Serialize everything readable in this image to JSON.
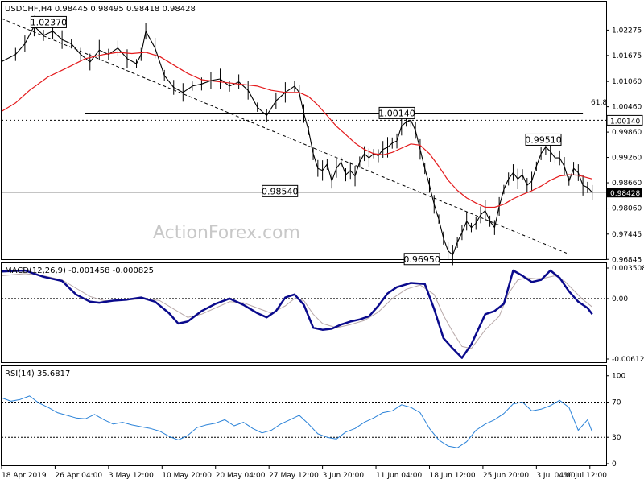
{
  "chart_data": [
    {
      "type": "line",
      "title": "USDCHF,H4",
      "ohlc_label": "0.98445 0.98495 0.98418 0.98428",
      "watermark": "ActionForex.com",
      "ylim": [
        0.9685,
        1.0295
      ],
      "y_ticks": [
        "1.02275",
        "1.01675",
        "1.01060",
        "1.00460",
        "0.99860",
        "0.99260",
        "0.98660",
        "0.98060",
        "0.97445",
        "0.96845"
      ],
      "current_price": "0.98428",
      "fib_label": "61.8",
      "fib_level": 1.0014,
      "fib_value_label": "1.00140",
      "fib_line": {
        "x": [
          18,
          125
        ],
        "y": 1.0031
      },
      "trendline": {
        "x": [
          0,
          122
        ],
        "y": [
          1.0255,
          0.9697
        ]
      },
      "x_range": [
        0,
        130
      ],
      "annotations": [
        {
          "text": "1.02370",
          "x": 7.0,
          "y": 1.0237
        },
        {
          "text": "0.98540",
          "x": 64.0,
          "y": 0.9854
        },
        {
          "text": "1.00140",
          "x": 85.0,
          "y": 1.0014
        },
        {
          "text": "0.96950",
          "x": 93.5,
          "y": 0.9695
        },
        {
          "text": "0.99510",
          "x": 116.5,
          "y": 0.9951
        }
      ],
      "price_points": [
        [
          0,
          1.0153
        ],
        [
          3,
          1.017
        ],
        [
          5,
          1.0195
        ],
        [
          7,
          1.0237
        ],
        [
          9,
          1.0215
        ],
        [
          11,
          1.0225
        ],
        [
          13,
          1.0205
        ],
        [
          15,
          1.0195
        ],
        [
          17,
          1.017
        ],
        [
          19,
          1.0152
        ],
        [
          21,
          1.018
        ],
        [
          23,
          1.017
        ],
        [
          25,
          1.0185
        ],
        [
          27,
          1.016
        ],
        [
          29,
          1.0148
        ],
        [
          30,
          1.017
        ],
        [
          31,
          1.0225
        ],
        [
          33,
          1.0185
        ],
        [
          35,
          1.012
        ],
        [
          37,
          1.0092
        ],
        [
          39,
          1.008
        ],
        [
          41,
          1.0095
        ],
        [
          43,
          1.01
        ],
        [
          45,
          1.0108
        ],
        [
          47,
          1.0112
        ],
        [
          49,
          1.0095
        ],
        [
          51,
          1.0105
        ],
        [
          53,
          1.0085
        ],
        [
          55,
          1.0045
        ],
        [
          57,
          1.0025
        ],
        [
          59,
          1.006
        ],
        [
          61,
          1.008
        ],
        [
          63,
          1.0095
        ],
        [
          64,
          1.008
        ],
        [
          65,
          1.003
        ],
        [
          66,
          0.999
        ],
        [
          67,
          0.9935
        ],
        [
          68,
          0.99
        ],
        [
          69,
          0.9895
        ],
        [
          70,
          0.991
        ],
        [
          71,
          0.987
        ],
        [
          72,
          0.99
        ],
        [
          73,
          0.9915
        ],
        [
          74,
          0.9885
        ],
        [
          75,
          0.9895
        ],
        [
          76,
          0.9882
        ],
        [
          77,
          0.9915
        ],
        [
          78,
          0.9935
        ],
        [
          79,
          0.9925
        ],
        [
          80,
          0.9935
        ],
        [
          81,
          0.993
        ],
        [
          82,
          0.9945
        ],
        [
          83,
          0.995
        ],
        [
          84,
          0.996
        ],
        [
          85,
          0.9965
        ],
        [
          86,
          1.0
        ],
        [
          87,
          1.001
        ],
        [
          88,
          1.0014
        ],
        [
          89,
          0.999
        ],
        [
          90,
          0.9945
        ],
        [
          91,
          0.99
        ],
        [
          92,
          0.986
        ],
        [
          93,
          0.9815
        ],
        [
          94,
          0.978
        ],
        [
          95,
          0.9735
        ],
        [
          96,
          0.9705
        ],
        [
          97,
          0.9695
        ],
        [
          98,
          0.9725
        ],
        [
          99,
          0.9748
        ],
        [
          100,
          0.9775
        ],
        [
          101,
          0.976
        ],
        [
          102,
          0.977
        ],
        [
          103,
          0.979
        ],
        [
          104,
          0.98
        ],
        [
          105,
          0.9775
        ],
        [
          106,
          0.976
        ],
        [
          107,
          0.981
        ],
        [
          108,
          0.985
        ],
        [
          109,
          0.9875
        ],
        [
          110,
          0.989
        ],
        [
          111,
          0.9875
        ],
        [
          112,
          0.9885
        ],
        [
          113,
          0.986
        ],
        [
          114,
          0.987
        ],
        [
          115,
          0.9905
        ],
        [
          116,
          0.9935
        ],
        [
          117,
          0.9951
        ],
        [
          118,
          0.994
        ],
        [
          119,
          0.9925
        ],
        [
          120,
          0.9925
        ],
        [
          121,
          0.9905
        ],
        [
          122,
          0.987
        ],
        [
          123,
          0.99
        ],
        [
          124,
          0.989
        ],
        [
          125,
          0.986
        ],
        [
          126,
          0.9855
        ],
        [
          127,
          0.9843
        ]
      ],
      "ma_points": [
        [
          0,
          1.0035
        ],
        [
          3,
          1.0055
        ],
        [
          6,
          1.0085
        ],
        [
          10,
          1.0117
        ],
        [
          14,
          1.0138
        ],
        [
          18,
          1.016
        ],
        [
          22,
          1.017
        ],
        [
          25,
          1.0175
        ],
        [
          28,
          1.0172
        ],
        [
          31,
          1.0175
        ],
        [
          34,
          1.0165
        ],
        [
          37,
          1.0145
        ],
        [
          40,
          1.0125
        ],
        [
          43,
          1.011
        ],
        [
          47,
          1.0105
        ],
        [
          51,
          1.01
        ],
        [
          55,
          1.0095
        ],
        [
          58,
          1.0085
        ],
        [
          61,
          1.008
        ],
        [
          64,
          1.008
        ],
        [
          66,
          1.007
        ],
        [
          68,
          1.005
        ],
        [
          70,
          1.0025
        ],
        [
          72,
          1.0
        ],
        [
          74,
          0.998
        ],
        [
          76,
          0.996
        ],
        [
          78,
          0.9945
        ],
        [
          80,
          0.9935
        ],
        [
          82,
          0.9932
        ],
        [
          84,
          0.9938
        ],
        [
          86,
          0.9948
        ],
        [
          88,
          0.9958
        ],
        [
          90,
          0.9955
        ],
        [
          92,
          0.9935
        ],
        [
          94,
          0.9905
        ],
        [
          96,
          0.9872
        ],
        [
          98,
          0.9848
        ],
        [
          100,
          0.983
        ],
        [
          102,
          0.9818
        ],
        [
          104,
          0.9808
        ],
        [
          106,
          0.9808
        ],
        [
          108,
          0.9815
        ],
        [
          110,
          0.9828
        ],
        [
          112,
          0.9838
        ],
        [
          114,
          0.9847
        ],
        [
          116,
          0.9858
        ],
        [
          118,
          0.9872
        ],
        [
          120,
          0.9882
        ],
        [
          122,
          0.9885
        ],
        [
          124,
          0.9884
        ],
        [
          126,
          0.9878
        ],
        [
          127,
          0.9875
        ]
      ]
    },
    {
      "type": "line",
      "title": "MACD(12,26,9) -0.001458 -0.000825",
      "ylim": [
        -0.00612,
        0.0034
      ],
      "y_ticks": [
        "0.003508",
        "0.00",
        "-0.006121"
      ],
      "zero_line": 0,
      "macd_points": [
        [
          0,
          0.0026
        ],
        [
          5,
          0.0027
        ],
        [
          9,
          0.0021
        ],
        [
          13,
          0.0017
        ],
        [
          16,
          0.0004
        ],
        [
          19,
          -0.0003
        ],
        [
          21,
          -0.0004
        ],
        [
          24,
          -0.0002
        ],
        [
          27,
          -0.0001
        ],
        [
          30,
          0.0001
        ],
        [
          33,
          -0.0003
        ],
        [
          36,
          -0.0014
        ],
        [
          38,
          -0.0024
        ],
        [
          40,
          -0.0022
        ],
        [
          43,
          -0.0012
        ],
        [
          46,
          -0.0005
        ],
        [
          49,
          0.0
        ],
        [
          52,
          -0.0006
        ],
        [
          55,
          -0.0014
        ],
        [
          57,
          -0.0018
        ],
        [
          59,
          -0.0012
        ],
        [
          61,
          0.0001
        ],
        [
          63,
          0.0004
        ],
        [
          65,
          -0.0006
        ],
        [
          67,
          -0.0028
        ],
        [
          69,
          -0.003
        ],
        [
          71,
          -0.0029
        ],
        [
          73,
          -0.0025
        ],
        [
          75,
          -0.0022
        ],
        [
          77,
          -0.002
        ],
        [
          79,
          -0.0017
        ],
        [
          81,
          -0.0007
        ],
        [
          83,
          0.0005
        ],
        [
          85,
          0.0011
        ],
        [
          88,
          0.0015
        ],
        [
          91,
          0.0014
        ],
        [
          93,
          -0.001
        ],
        [
          95,
          -0.0038
        ],
        [
          97,
          -0.0048
        ],
        [
          99,
          -0.0057
        ],
        [
          101,
          -0.0044
        ],
        [
          104,
          -0.0015
        ],
        [
          106,
          -0.0012
        ],
        [
          108,
          -0.0005
        ],
        [
          110,
          0.0027
        ],
        [
          112,
          0.0022
        ],
        [
          114,
          0.0016
        ],
        [
          116,
          0.0018
        ],
        [
          118,
          0.0027
        ],
        [
          120,
          0.002
        ],
        [
          122,
          0.0007
        ],
        [
          124,
          -0.0003
        ],
        [
          126,
          -0.0009
        ],
        [
          127,
          -0.0015
        ]
      ],
      "signal_points": [
        [
          0,
          0.0022
        ],
        [
          5,
          0.0024
        ],
        [
          9,
          0.0022
        ],
        [
          13,
          0.0018
        ],
        [
          16,
          0.001
        ],
        [
          19,
          0.0002
        ],
        [
          22,
          -0.0002
        ],
        [
          25,
          -0.0002
        ],
        [
          28,
          -0.0001
        ],
        [
          31,
          0.0
        ],
        [
          34,
          -0.0002
        ],
        [
          37,
          -0.001
        ],
        [
          40,
          -0.0018
        ],
        [
          43,
          -0.0015
        ],
        [
          46,
          -0.0009
        ],
        [
          49,
          -0.0003
        ],
        [
          52,
          -0.0004
        ],
        [
          55,
          -0.0009
        ],
        [
          58,
          -0.0014
        ],
        [
          61,
          -0.0007
        ],
        [
          63,
          0.0
        ],
        [
          65,
          -0.0002
        ],
        [
          67,
          -0.0015
        ],
        [
          69,
          -0.0024
        ],
        [
          72,
          -0.0028
        ],
        [
          75,
          -0.0025
        ],
        [
          78,
          -0.0021
        ],
        [
          81,
          -0.0013
        ],
        [
          84,
          0.0
        ],
        [
          87,
          0.0009
        ],
        [
          90,
          0.0013
        ],
        [
          93,
          0.0004
        ],
        [
          95,
          -0.0016
        ],
        [
          97,
          -0.0032
        ],
        [
          99,
          -0.0046
        ],
        [
          101,
          -0.0048
        ],
        [
          104,
          -0.003
        ],
        [
          107,
          -0.0017
        ],
        [
          109,
          0.0005
        ],
        [
          111,
          0.0018
        ],
        [
          113,
          0.002
        ],
        [
          115,
          0.0019
        ],
        [
          117,
          0.002
        ],
        [
          119,
          0.0022
        ],
        [
          121,
          0.0017
        ],
        [
          123,
          0.0008
        ],
        [
          125,
          -0.0001
        ],
        [
          127,
          -0.0008
        ]
      ]
    },
    {
      "type": "line",
      "title": "RSI(14) 35.6817",
      "ylim": [
        0,
        100
      ],
      "y_ticks": [
        "100",
        "70",
        "30",
        "0"
      ],
      "levels": [
        70,
        30
      ],
      "rsi_points": [
        [
          0,
          75
        ],
        [
          2,
          71
        ],
        [
          4,
          73
        ],
        [
          6,
          77
        ],
        [
          8,
          69
        ],
        [
          10,
          64
        ],
        [
          12,
          58
        ],
        [
          14,
          55
        ],
        [
          16,
          52
        ],
        [
          18,
          51
        ],
        [
          20,
          56
        ],
        [
          22,
          50
        ],
        [
          24,
          45
        ],
        [
          26,
          47
        ],
        [
          28,
          44
        ],
        [
          30,
          42
        ],
        [
          32,
          40
        ],
        [
          34,
          37
        ],
        [
          36,
          31
        ],
        [
          38,
          27
        ],
        [
          40,
          32
        ],
        [
          42,
          41
        ],
        [
          44,
          44
        ],
        [
          46,
          46
        ],
        [
          48,
          50
        ],
        [
          50,
          43
        ],
        [
          52,
          47
        ],
        [
          54,
          40
        ],
        [
          56,
          35
        ],
        [
          58,
          38
        ],
        [
          60,
          45
        ],
        [
          62,
          50
        ],
        [
          64,
          55
        ],
        [
          66,
          45
        ],
        [
          68,
          34
        ],
        [
          70,
          30
        ],
        [
          72,
          28
        ],
        [
          74,
          36
        ],
        [
          76,
          40
        ],
        [
          78,
          47
        ],
        [
          80,
          52
        ],
        [
          82,
          58
        ],
        [
          84,
          60
        ],
        [
          86,
          67
        ],
        [
          88,
          64
        ],
        [
          90,
          58
        ],
        [
          92,
          40
        ],
        [
          94,
          27
        ],
        [
          96,
          20
        ],
        [
          98,
          18
        ],
        [
          100,
          25
        ],
        [
          102,
          38
        ],
        [
          104,
          45
        ],
        [
          106,
          50
        ],
        [
          108,
          57
        ],
        [
          110,
          68
        ],
        [
          112,
          70
        ],
        [
          114,
          60
        ],
        [
          116,
          62
        ],
        [
          118,
          66
        ],
        [
          120,
          72
        ],
        [
          122,
          64
        ],
        [
          124,
          38
        ],
        [
          126,
          50
        ],
        [
          127,
          36
        ]
      ],
      "x_tick_labels": [
        "18 Apr 2019",
        "26 Apr 04:00",
        "3 May 12:00",
        "10 May 20:00",
        "20 May 04:00",
        "27 May 12:00",
        "3 Jun 20:00",
        "11 Jun 04:00",
        "18 Jun 12:00",
        "25 Jun 20:00",
        "3 Jul 04:00",
        "10 Jul 12:00"
      ],
      "x_tick_positions": [
        0,
        11.5,
        23,
        34.5,
        46,
        57.5,
        69,
        80.5,
        92,
        103.5,
        115,
        126.5
      ]
    }
  ],
  "colors": {
    "price": "#000000",
    "ma": "#e41a1c",
    "macd": "#0a0a8c",
    "signal": "#b8a9a9",
    "rsi": "#2a82d8",
    "dashed": "#000000"
  }
}
